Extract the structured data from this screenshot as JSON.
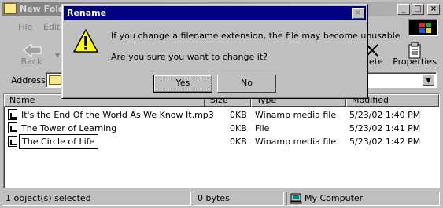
{
  "window": {
    "title": "New Fold",
    "controls": {
      "minimize": "_",
      "maximize": "□",
      "close": "×"
    }
  },
  "menu": [
    "File",
    "Edit"
  ],
  "toolbar": {
    "back": "Back",
    "delete": "elete",
    "properties": "Properties"
  },
  "address": {
    "label": "Address"
  },
  "list": {
    "columns": {
      "name": "Name",
      "size": "Size",
      "type": "Type",
      "modified": "Modified"
    },
    "rows": [
      {
        "name": "It's the End Of the World As We Know It.mp3",
        "size": "0KB",
        "type": "Winamp media file",
        "modified": "5/23/02 1:40 PM"
      },
      {
        "name": "The Tower of Learning",
        "size": "0KB",
        "type": "File",
        "modified": "5/23/02 1:41 PM"
      },
      {
        "name": "The Circle of Life",
        "size": "0KB",
        "type": "Winamp media file",
        "modified": "5/23/02 1:42 PM"
      }
    ]
  },
  "status": {
    "selected": "1 object(s) selected",
    "bytes": "0 bytes",
    "location": "My Computer"
  },
  "dialog": {
    "title": "Rename",
    "close": "×",
    "message1": "If you change a filename extension, the file may become unusable.",
    "message2": "Are you sure you want to change it?",
    "yes": "Yes",
    "no": "No"
  },
  "colors": {
    "dialog_titlebar": "#000080",
    "face": "#c0c0c0",
    "inactive_titlebar": "#808080"
  },
  "icons": {
    "dialog": "warning-icon",
    "address": "folder-icon"
  }
}
